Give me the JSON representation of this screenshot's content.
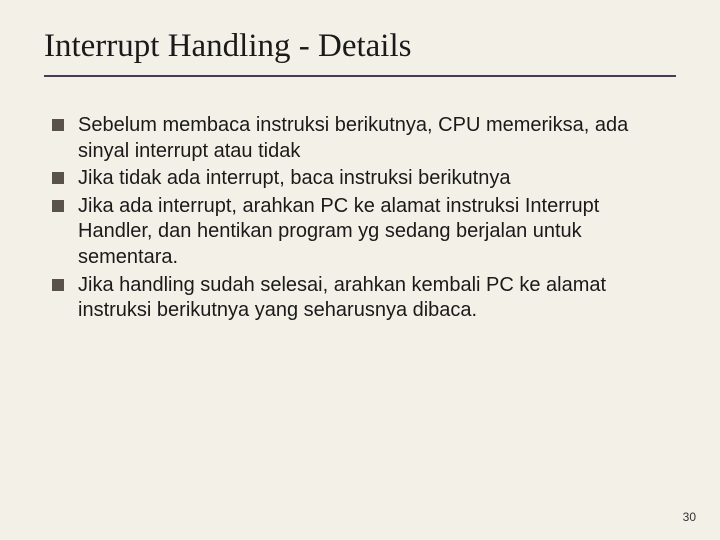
{
  "title": "Interrupt Handling - Details",
  "bullets": [
    "Sebelum membaca instruksi berikutnya, CPU memeriksa, ada sinyal interrupt atau tidak",
    "Jika tidak ada interrupt, baca instruksi berikutnya",
    "Jika ada interrupt, arahkan PC ke alamat instruksi Interrupt Handler, dan hentikan program yg sedang berjalan untuk sementara.",
    "Jika handling sudah selesai, arahkan kembali PC ke alamat instruksi berikutnya yang seharusnya dibaca."
  ],
  "page_number": "30"
}
